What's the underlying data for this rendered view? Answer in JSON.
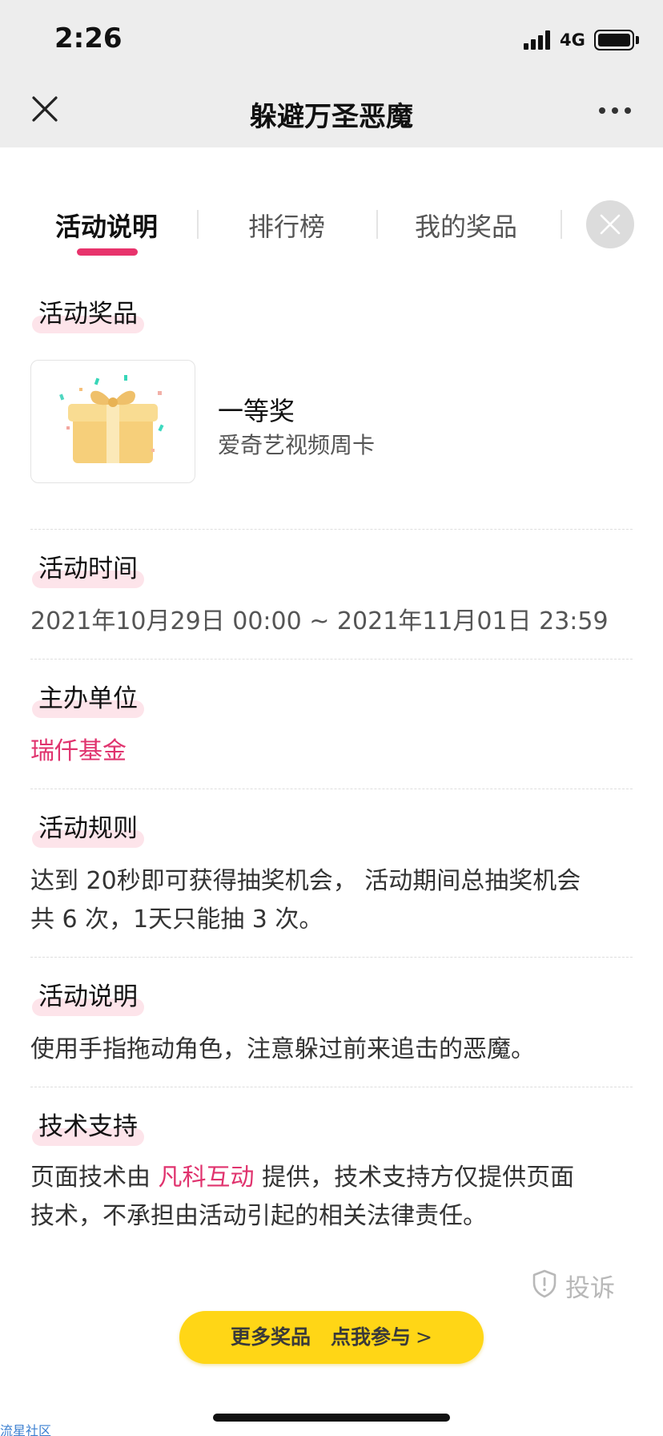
{
  "status": {
    "time": "2:26",
    "network": "4G"
  },
  "nav": {
    "title": "躲避万圣恶魔"
  },
  "tabs": [
    {
      "label": "活动说明"
    },
    {
      "label": "排行榜"
    },
    {
      "label": "我的奖品"
    }
  ],
  "sections": {
    "prizes": {
      "heading": "活动奖品",
      "items": [
        {
          "name": "一等奖",
          "desc": "爱奇艺视频周卡"
        }
      ]
    },
    "time": {
      "heading": "活动时间",
      "value": "2021年10月29日 00:00 ~ 2021年11月01日 23:59"
    },
    "organizer": {
      "heading": "主办单位",
      "value": "瑞仟基金"
    },
    "rules": {
      "heading": "活动规则",
      "line1": "达到 20秒即可获得抽奖机会， 活动期间总抽奖机会",
      "line2": "共 6 次，1天只能抽 3 次。"
    },
    "description": {
      "heading": "活动说明",
      "text": "使用手指拖动角色，注意躲过前来追击的恶魔。"
    },
    "support": {
      "heading": "技术支持",
      "prefix": "页面技术由 ",
      "provider": "凡科互动",
      "suffix": " 提供，技术支持方仅提供页面",
      "line2": "技术，不承担由活动引起的相关法律责任。"
    }
  },
  "report": {
    "label": "投诉"
  },
  "cta": {
    "label": "更多奖品　点我参与",
    "arrow": ">"
  },
  "watermark": "流星社区",
  "colors": {
    "accent": "#e0336e",
    "tab_underline": "#e8336c",
    "cta": "#ffd616",
    "label_highlight": "#fde4ea",
    "chrome": "#ededed"
  },
  "icons": [
    "close-icon",
    "more-icon",
    "panel-close-icon",
    "gift-icon",
    "shield-icon",
    "signal-icon",
    "battery-icon"
  ]
}
